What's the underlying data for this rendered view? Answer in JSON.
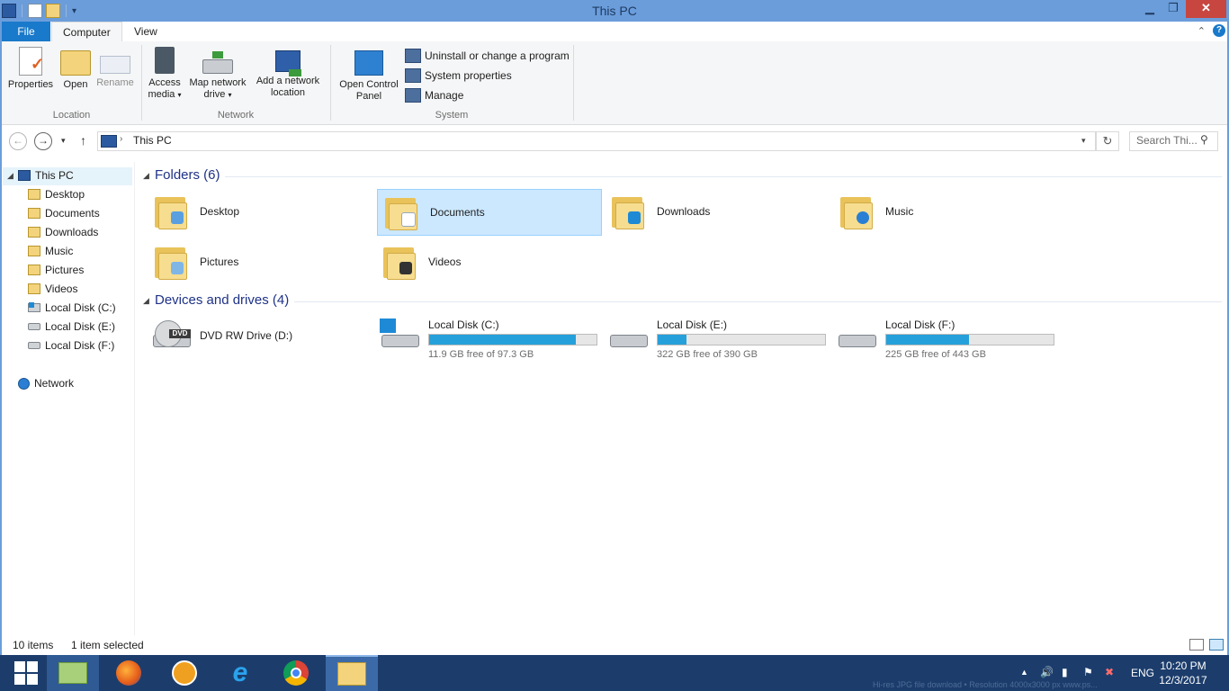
{
  "window": {
    "title": "This PC"
  },
  "window_controls": {
    "minimize": "▁",
    "maximize": "❐",
    "close": "✕"
  },
  "ribbon": {
    "tabs": {
      "file": "File",
      "computer": "Computer",
      "view": "View"
    },
    "groups": {
      "location": {
        "label": "Location",
        "properties": "Properties",
        "open": "Open",
        "rename": "Rename"
      },
      "network": {
        "label": "Network",
        "access_media_1": "Access",
        "access_media_2": "media",
        "map_drive_1": "Map network",
        "map_drive_2": "drive",
        "add_location_1": "Add a network",
        "add_location_2": "location"
      },
      "system": {
        "label": "System",
        "control_panel_1": "Open Control",
        "control_panel_2": "Panel",
        "uninstall": "Uninstall or change a program",
        "system_properties": "System properties",
        "manage": "Manage"
      }
    }
  },
  "address_bar": {
    "path": "This PC",
    "search_placeholder": "Search Thi..."
  },
  "nav_pane": {
    "items": [
      {
        "label": "This PC"
      },
      {
        "label": "Desktop"
      },
      {
        "label": "Documents"
      },
      {
        "label": "Downloads"
      },
      {
        "label": "Music"
      },
      {
        "label": "Pictures"
      },
      {
        "label": "Videos"
      },
      {
        "label": "Local Disk (C:)"
      },
      {
        "label": "Local Disk (E:)"
      },
      {
        "label": "Local Disk (F:)"
      },
      {
        "label": "Network"
      }
    ]
  },
  "content": {
    "folders_header": "Folders (6)",
    "folders": [
      {
        "name": "Desktop",
        "selected": false
      },
      {
        "name": "Documents",
        "selected": true
      },
      {
        "name": "Downloads",
        "selected": false
      },
      {
        "name": "Music",
        "selected": false
      },
      {
        "name": "Pictures",
        "selected": false
      },
      {
        "name": "Videos",
        "selected": false
      }
    ],
    "drives_header": "Devices and drives (4)",
    "drives": [
      {
        "name": "DVD RW Drive (D:)"
      },
      {
        "name": "Local Disk (C:)",
        "free": "11.9 GB free of 97.3 GB",
        "used_fraction": 0.878
      },
      {
        "name": "Local Disk (E:)",
        "free": "322 GB free of 390 GB",
        "used_fraction": 0.174
      },
      {
        "name": "Local Disk (F:)",
        "free": "225 GB free of 443 GB",
        "used_fraction": 0.492
      }
    ]
  },
  "status_bar": {
    "items": "10 items",
    "selected": "1 item selected"
  },
  "taskbar": {
    "apps": [
      "start-button",
      "desktop-app",
      "firefox",
      "safari",
      "internet-explorer",
      "chrome",
      "file-explorer"
    ],
    "tray_lang": "ENG",
    "time": "10:20 PM",
    "date": "12/3/2017",
    "watermark": "Hi-res JPG file download   •   Resolution 4000x3000 px   www.ps..."
  },
  "colors": {
    "accent": "#1979ca",
    "title_bar": "#6b9ddb",
    "taskbar": "#1c3d6c",
    "selection": "#cce8ff",
    "drive_bar": "#26a0da"
  }
}
